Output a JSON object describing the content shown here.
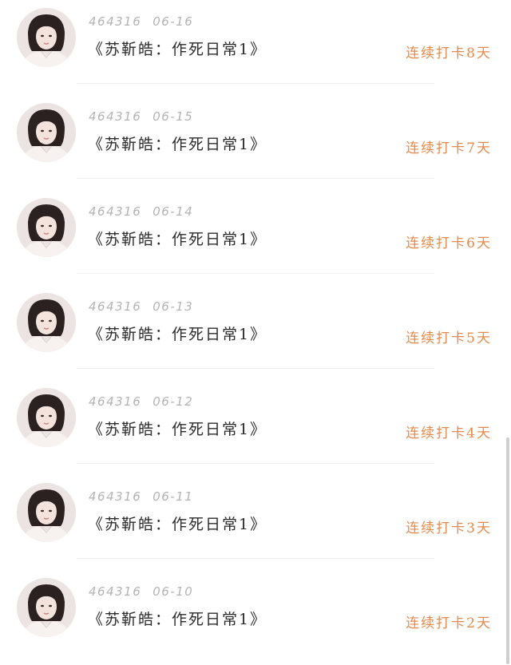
{
  "entries": [
    {
      "user_id": "464316",
      "date": "06-16",
      "title": "《苏靳皓：作死日常1》",
      "streak": "连续打卡8天"
    },
    {
      "user_id": "464316",
      "date": "06-15",
      "title": "《苏靳皓：作死日常1》",
      "streak": "连续打卡7天"
    },
    {
      "user_id": "464316",
      "date": "06-14",
      "title": "《苏靳皓：作死日常1》",
      "streak": "连续打卡6天"
    },
    {
      "user_id": "464316",
      "date": "06-13",
      "title": "《苏靳皓：作死日常1》",
      "streak": "连续打卡5天"
    },
    {
      "user_id": "464316",
      "date": "06-12",
      "title": "《苏靳皓：作死日常1》",
      "streak": "连续打卡4天"
    },
    {
      "user_id": "464316",
      "date": "06-11",
      "title": "《苏靳皓：作死日常1》",
      "streak": "连续打卡3天"
    },
    {
      "user_id": "464316",
      "date": "06-10",
      "title": "《苏靳皓：作死日常1》",
      "streak": "连续打卡2天"
    }
  ],
  "colors": {
    "streak": "#e58a4e",
    "meta": "#b3b3b3",
    "title": "#2b2b2b",
    "divider": "#f0f0f0"
  },
  "icons": {
    "avatar": "user-avatar-photo"
  }
}
